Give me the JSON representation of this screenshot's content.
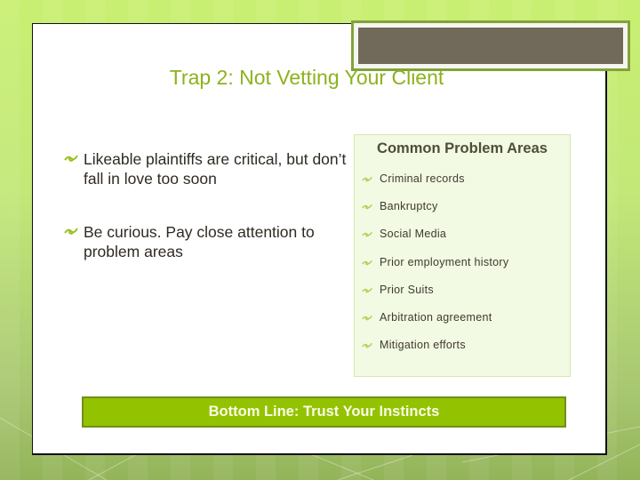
{
  "slide": {
    "title": "Trap 2:  Not Vetting Your Client",
    "bullet_icon": "fleuron-bullet-icon",
    "left_bullets": [
      "Likeable plaintiffs are critical, but don’t fall in love too soon",
      "Be curious.  Pay close attention to problem areas"
    ],
    "problems": {
      "title": "Common Problem Areas",
      "items": [
        "Criminal records",
        "Bankruptcy",
        "Social Media",
        "Prior employment history",
        "Prior Suits",
        "Arbitration agreement",
        "Mitigation efforts"
      ]
    },
    "bottom_line": "Bottom Line:  Trust Your Instincts",
    "colors": {
      "title": "#8cb21e",
      "bullet": "#9ac21e",
      "banner": "#93c300",
      "banner_border": "#6f8f19",
      "accent_box": "#716959",
      "problems_bg": "#f2fae3"
    }
  }
}
